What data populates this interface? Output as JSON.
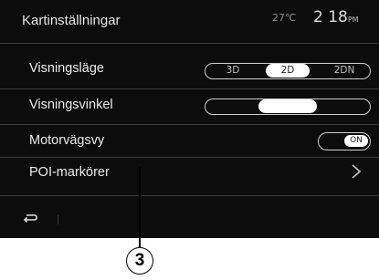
{
  "header": {
    "title": "Kartinställningar",
    "temperature": "27℃",
    "time": "2 18",
    "time_suffix": "PM"
  },
  "settings": {
    "display_mode": {
      "label": "Visningsläge",
      "options": [
        "3D",
        "2D",
        "2DN"
      ],
      "selected": "2D"
    },
    "view_angle": {
      "label": "Visningsvinkel",
      "level": 0.5
    },
    "highway_view": {
      "label": "Motorvägsvy",
      "state": "ON"
    },
    "poi_markers": {
      "label": "POI-markörer"
    }
  },
  "footer": {
    "back_icon": "back-arrow-icon"
  },
  "callout": {
    "number": "3"
  },
  "colors": {
    "screen_background": "#0c0c0c",
    "text": "#eaeaea",
    "divider": "#3a3a3a",
    "active_option": "#ffffff"
  }
}
